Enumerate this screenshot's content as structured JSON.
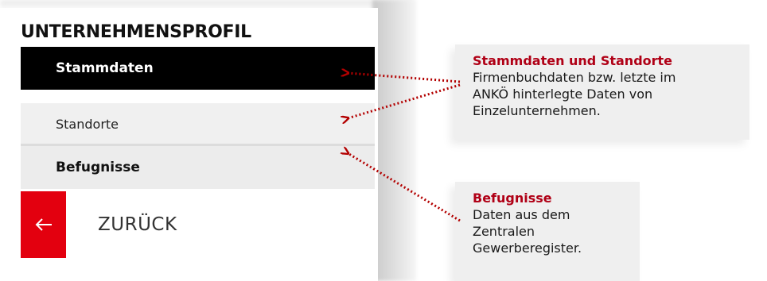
{
  "sidebar": {
    "title": "UNTERNEHMENSPROFIL",
    "items": [
      {
        "label": "Stammdaten",
        "state": "active"
      },
      {
        "label": "Standorte",
        "state": "normal"
      },
      {
        "label": "Befugnisse",
        "state": "bold"
      }
    ],
    "back": {
      "label": "ZURÜCK",
      "icon": "arrow-left-icon"
    }
  },
  "callouts": [
    {
      "heading": "Stammdaten und Standorte",
      "lines": [
        "Firmenbuchdaten bzw. letzte im",
        "ANKÖ hinterlegte Daten von",
        "Einzelunternehmen."
      ]
    },
    {
      "heading": "Befugnisse",
      "lines": [
        "Daten aus dem",
        "Zentralen",
        "Gewerberegister."
      ]
    }
  ],
  "colors": {
    "accent_red": "#e3000f",
    "heading_red": "#b00016",
    "arrow_red": "#b30000",
    "active_bg": "#000000"
  }
}
